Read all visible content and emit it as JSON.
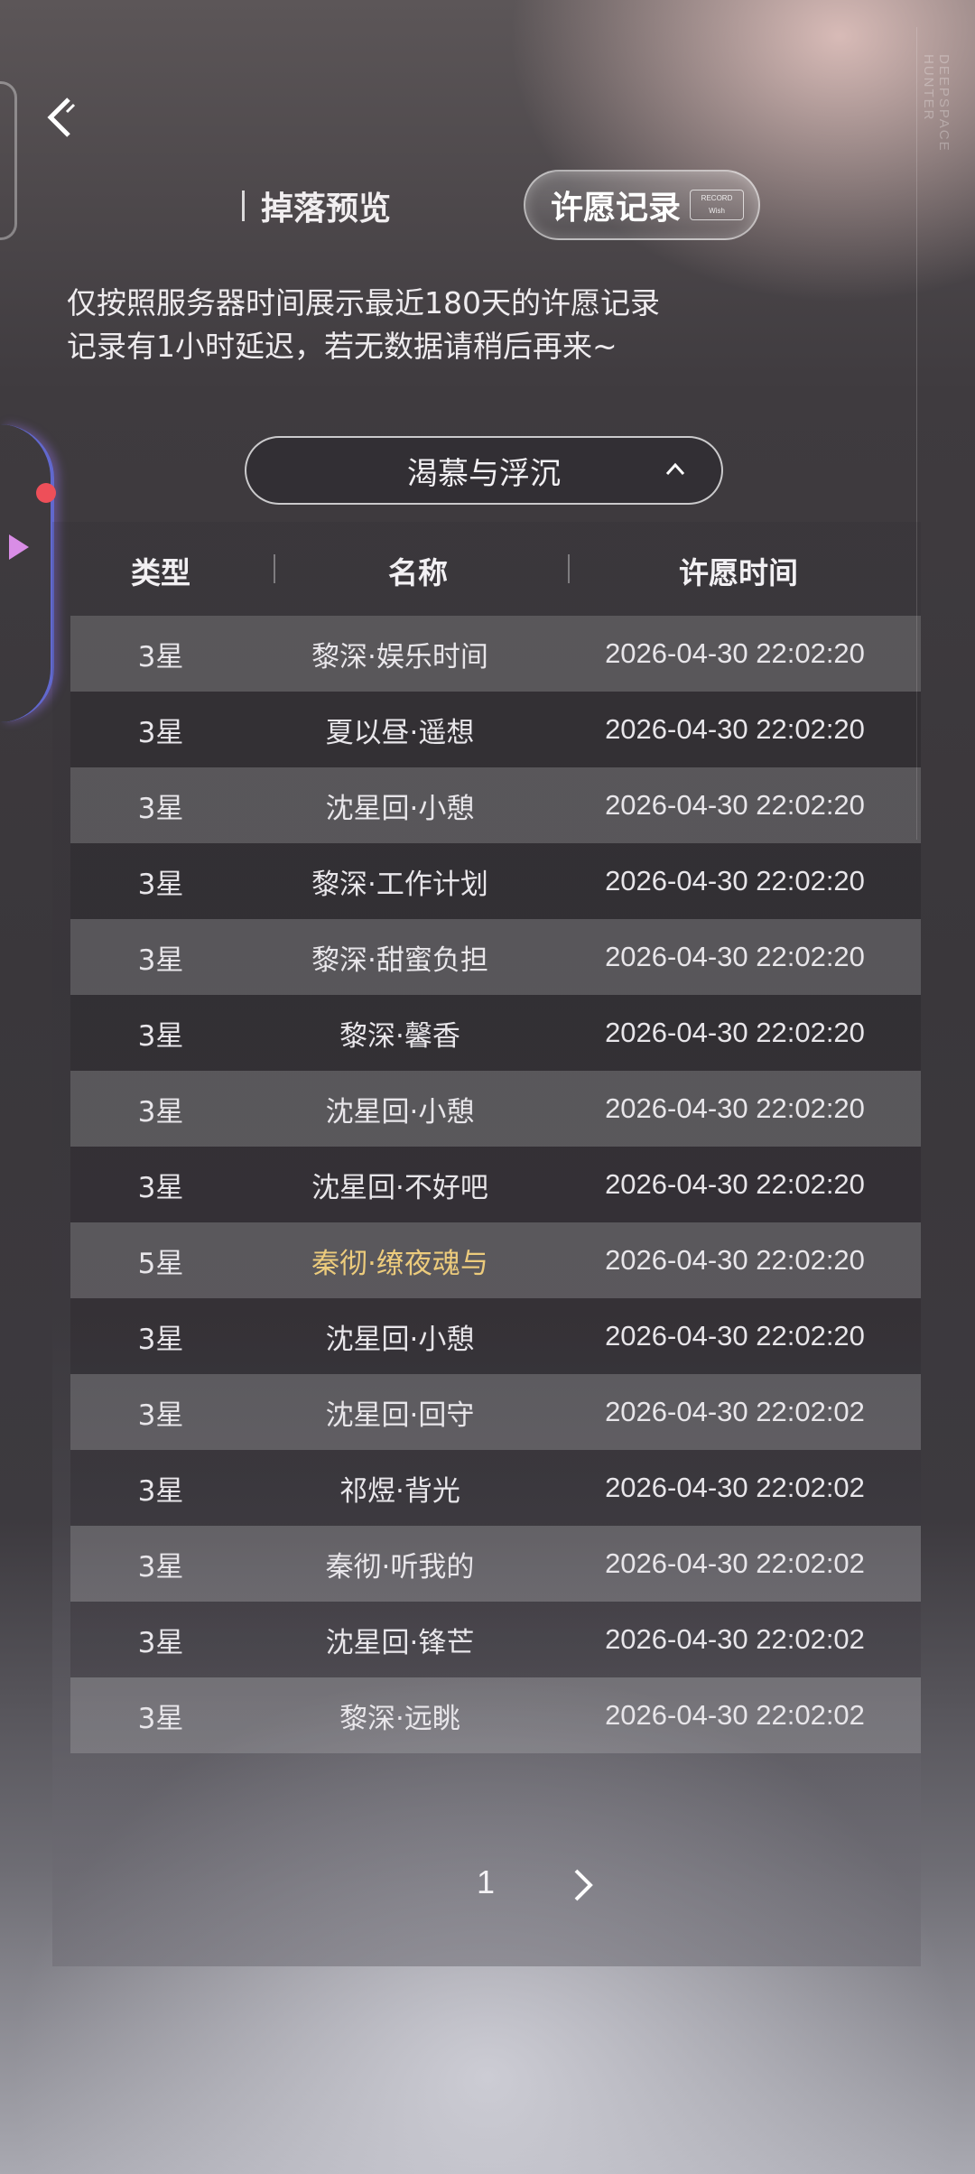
{
  "deco": {
    "brand_text": "DEEPSPACE HUNTER"
  },
  "tabs": {
    "drop_preview": "掉落预览",
    "wish_record": "许愿记录",
    "wish_record_badge_line1": "RECORD",
    "wish_record_badge_line2": "Wish"
  },
  "notice": {
    "line1": "仅按照服务器时间展示最近180天的许愿记录",
    "line2": "记录有1小时延迟，若无数据请稍后再来~"
  },
  "banner_select": {
    "value": "渴慕与浮沉",
    "expanded": true
  },
  "table": {
    "headers": {
      "type": "类型",
      "name": "名称",
      "time": "许愿时间"
    },
    "rows": [
      {
        "type": "3星",
        "name": "黎深·娱乐时间",
        "time": "2026-04-30 22:02:20"
      },
      {
        "type": "3星",
        "name": "夏以昼·遥想",
        "time": "2026-04-30 22:02:20"
      },
      {
        "type": "3星",
        "name": "沈星回·小憩",
        "time": "2026-04-30 22:02:20"
      },
      {
        "type": "3星",
        "name": "黎深·工作计划",
        "time": "2026-04-30 22:02:20"
      },
      {
        "type": "3星",
        "name": "黎深·甜蜜负担",
        "time": "2026-04-30 22:02:20"
      },
      {
        "type": "3星",
        "name": "黎深·馨香",
        "time": "2026-04-30 22:02:20"
      },
      {
        "type": "3星",
        "name": "沈星回·小憩",
        "time": "2026-04-30 22:02:20"
      },
      {
        "type": "3星",
        "name": "沈星回·不好吧",
        "time": "2026-04-30 22:02:20"
      },
      {
        "type": "5星",
        "name": "秦彻·缭夜魂与",
        "time": "2026-04-30 22:02:20",
        "highlight": true
      },
      {
        "type": "3星",
        "name": "沈星回·小憩",
        "time": "2026-04-30 22:02:20"
      },
      {
        "type": "3星",
        "name": "沈星回·回守",
        "time": "2026-04-30 22:02:02"
      },
      {
        "type": "3星",
        "name": "祁煜·背光",
        "time": "2026-04-30 22:02:02"
      },
      {
        "type": "3星",
        "name": "秦彻·听我的",
        "time": "2026-04-30 22:02:02"
      },
      {
        "type": "3星",
        "name": "沈星回·锋芒",
        "time": "2026-04-30 22:02:02"
      },
      {
        "type": "3星",
        "name": "黎深·远眺",
        "time": "2026-04-30 22:02:02"
      }
    ]
  },
  "pager": {
    "current_page": "1"
  },
  "colors": {
    "gold_highlight": "#eccb7c",
    "accent_dot": "#ee4f59",
    "accent_arrow": "#d98de6"
  },
  "icons": {
    "back": "back-arrow-icon",
    "chevron": "chevron-up-icon",
    "next": "chevron-right-icon"
  }
}
